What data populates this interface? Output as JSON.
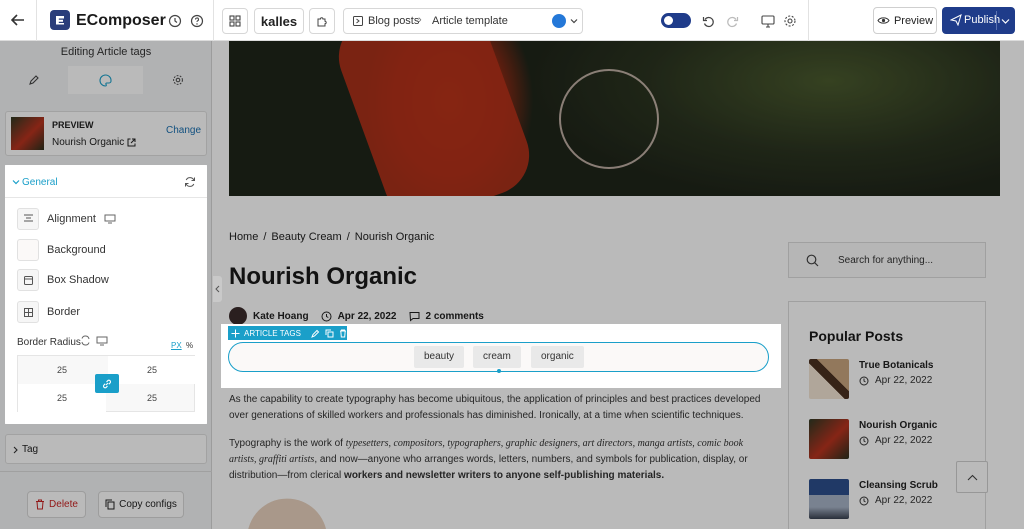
{
  "topbar": {
    "app_name": "EComposer",
    "store_name": "kalles",
    "breadcrumb": [
      "Blog posts",
      "Article template"
    ],
    "preview_label": "Preview",
    "publish_label": "Publish"
  },
  "left_panel": {
    "title": "Editing Article tags",
    "preview": {
      "label": "PREVIEW",
      "item": "Nourish Organic",
      "change_label": "Change"
    },
    "general": {
      "header": "General",
      "rows": [
        {
          "label": "Alignment",
          "icon": "align-center-icon"
        },
        {
          "label": "Background",
          "icon": "color-swatch-icon"
        },
        {
          "label": "Box Shadow",
          "icon": "box-shadow-icon"
        },
        {
          "label": "Border",
          "icon": "border-icon"
        }
      ],
      "border_radius": {
        "label": "Border Radius",
        "unit_px": "PX",
        "unit_pct": "%",
        "values": [
          "25",
          "25",
          "25",
          "25"
        ]
      }
    },
    "tag_section": "Tag",
    "delete_label": "Delete",
    "copy_label": "Copy configs"
  },
  "article": {
    "breadcrumb": [
      "Home",
      "Beauty Cream",
      "Nourish Organic"
    ],
    "title": "Nourish Organic",
    "author": "Kate Hoang",
    "date": "Apr 22, 2022",
    "comments": "2 comments",
    "tags_toolbar_label": "ARTICLE TAGS",
    "tags": [
      "beauty",
      "cream",
      "organic"
    ],
    "para1": "As the capability to create typography has become ubiquitous, the application of principles and best practices developed over generations of skilled workers and professionals has diminished. Ironically, at a time when scientific techniques.",
    "para2_lead": "Typography is the work of ",
    "para2_italic": "typesetters, compositors, typographers, graphic designers, art directors, manga artists, comic book artists, graffiti artists",
    "para2_mid": ", and now—anyone who arranges words, letters, numbers, and symbols for publication, display, or distribution—from clerical ",
    "para2_bold": "workers and newsletter writers to anyone self-publishing materials."
  },
  "sidebar": {
    "search_placeholder": "Search for anything...",
    "popular_title": "Popular Posts",
    "posts": [
      {
        "title": "True Botanicals",
        "date": "Apr 22, 2022"
      },
      {
        "title": "Nourish Organic",
        "date": "Apr 22, 2022"
      },
      {
        "title": "Cleansing Scrub",
        "date": "Apr 22, 2022"
      }
    ]
  },
  "colors": {
    "accent": "#1a9fc9",
    "publish": "#1f3c8a",
    "link": "#1a6fb0"
  }
}
